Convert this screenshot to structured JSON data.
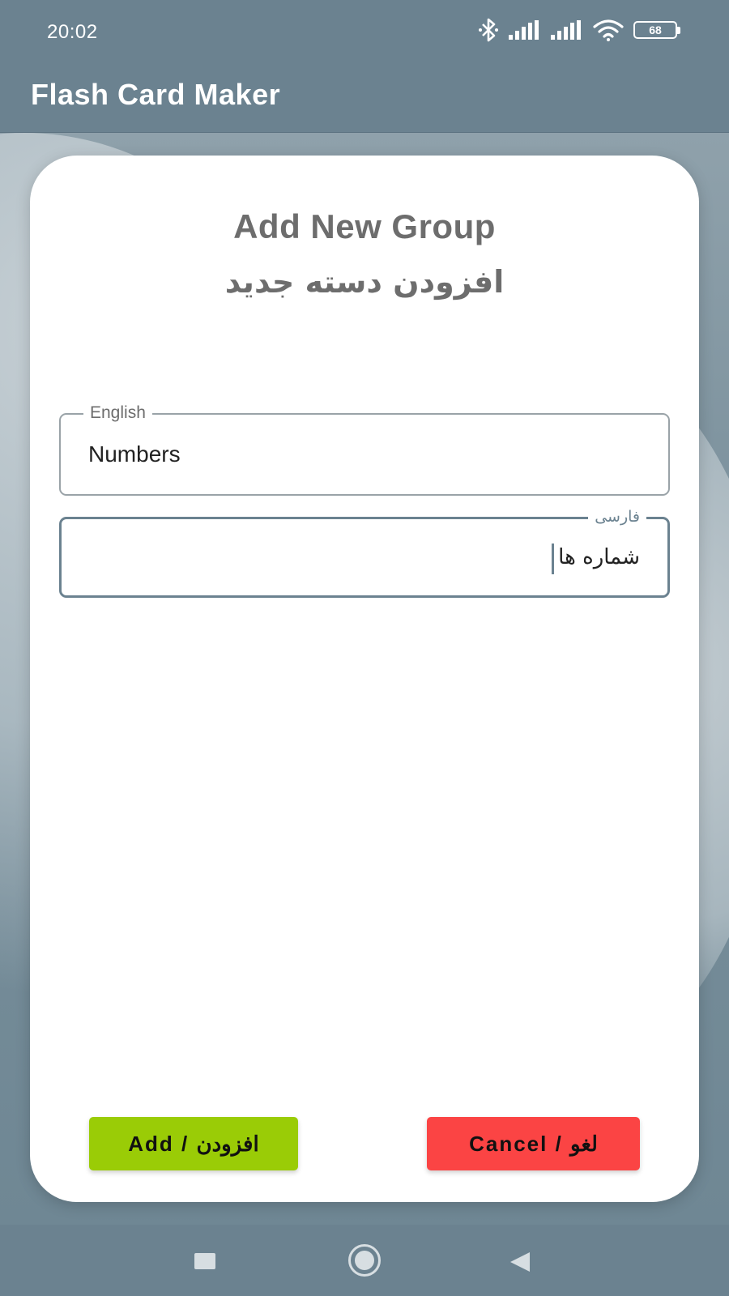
{
  "status_bar": {
    "time": "20:02",
    "battery_level": "68",
    "icons": [
      "bluetooth-icon",
      "signal-icon",
      "signal-icon",
      "wifi-icon",
      "battery-icon"
    ]
  },
  "app_bar": {
    "title": "Flash Card Maker"
  },
  "dialog": {
    "title_en": "Add New Group",
    "title_fa": "افزودن دسته جدید",
    "english_field": {
      "label": "English",
      "value": "Numbers"
    },
    "farsi_field": {
      "label": "فارسی",
      "value": "شماره ها"
    },
    "add_button_label": "Add / افزودن",
    "cancel_button_label": "Cancel / لغو"
  },
  "navigation": {
    "icons": [
      "recents-square-icon",
      "home-circle-icon",
      "back-triangle-icon"
    ]
  },
  "colors": {
    "primary": "#6b8290",
    "add_button": "#9acc06",
    "cancel_button": "#fb4444",
    "title_text": "#6d6d6d"
  }
}
